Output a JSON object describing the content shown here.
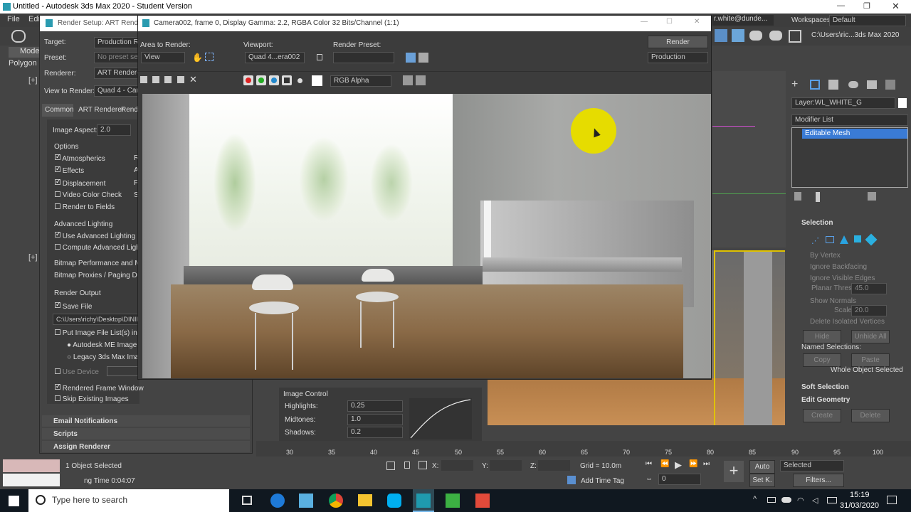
{
  "app_title": "Untitled - Autodesk 3ds Max 2020 - Student Version",
  "menu": [
    "File",
    "Edit"
  ],
  "account": "r.white@dunde...",
  "workspaces_label": "Workspaces:",
  "workspaces_value": "Default",
  "path_field": "C:\\Users\\ric...3ds Max 2020",
  "viewport_labels": {
    "top_left": "[+]",
    "mid_left": "[+]"
  },
  "left_toolbar": {
    "model_tab": "Model",
    "polygon_tab": "Polygon M"
  },
  "render_setup": {
    "title": "Render Setup: ART Rende",
    "target_label": "Target:",
    "target_value": "Production Ren",
    "preset_label": "Preset:",
    "preset_value": "No preset sele",
    "renderer_label": "Renderer:",
    "renderer_value": "ART Renderer",
    "view_label": "View to Render:",
    "view_value": "Quad 4 - Came",
    "tabs": [
      "Common",
      "ART Renderer",
      "Rende"
    ],
    "image_aspect_label": "Image Aspect:",
    "image_aspect_value": "2.0",
    "options_header": "Options",
    "options": [
      {
        "label": "Atmospherics",
        "checked": true
      },
      {
        "label": "Effects",
        "checked": true
      },
      {
        "label": "Displacement",
        "checked": true
      },
      {
        "label": "Video Color Check",
        "checked": false
      },
      {
        "label": "Render to Fields",
        "checked": false
      }
    ],
    "right_letters": [
      "R",
      "A",
      "F",
      "S"
    ],
    "advanced_lighting_header": "Advanced Lighting",
    "use_advanced_lighting": "Use Advanced Lighting",
    "compute_advanced_lighting": "Compute Advanced Lighting",
    "bitmap_performance": "Bitmap Performance and Memo",
    "bitmap_proxies": "Bitmap Proxies / Paging Disable",
    "render_output_header": "Render Output",
    "save_file": "Save File",
    "save_path": "C:\\Users\\richy\\Desktop\\DINING",
    "put_image_list": "Put Image File List(s) in Out",
    "autodesk_me": "Autodesk ME Image Se",
    "legacy": "Legacy 3ds Max Image",
    "use_device": "Use Device",
    "rendered_frame_window": "Rendered Frame Window",
    "skip_existing": "Skip Existing Images",
    "rollouts": [
      "Email Notifications",
      "Scripts",
      "Assign Renderer"
    ]
  },
  "render_frame": {
    "title": "Camera002, frame 0, Display Gamma: 2.2, RGBA Color 32 Bits/Channel (1:1)",
    "area_label": "Area to Render:",
    "area_value": "View",
    "viewport_label": "Viewport:",
    "viewport_value": "Quad 4...era002",
    "preset_label": "Render Preset:",
    "render_button": "Render",
    "production_value": "Production",
    "channel_value": "RGB Alpha"
  },
  "image_control": {
    "header": "Image Control",
    "highlights_label": "Highlights:",
    "highlights_value": "0.25",
    "midtones_label": "Midtones:",
    "midtones_value": "1.0",
    "shadows_label": "Shadows:",
    "shadows_value": "0.2"
  },
  "command_panel": {
    "layer": "Layer:WL_WHITE_G",
    "modifier_list": "Modifier List",
    "stack_item": "Editable Mesh",
    "selection_header": "Selection",
    "by_vertex": "By Vertex",
    "ignore_backfacing": "Ignore Backfacing",
    "ignore_visible_edges": "Ignore Visible Edges",
    "planar_thresh_label": "Planar Thresh:",
    "planar_thresh_value": "45.0",
    "show_normals": "Show Normals",
    "scale_label": "Scale:",
    "scale_value": "20.0",
    "delete_isolated": "Delete Isolated Vertices",
    "hide": "Hide",
    "unhide_all": "Unhide All",
    "named_selections": "Named Selections:",
    "copy": "Copy",
    "paste": "Paste",
    "whole_object": "Whole Object Selected",
    "soft_selection": "Soft Selection",
    "edit_geometry": "Edit Geometry",
    "create": "Create",
    "delete": "Delete"
  },
  "timeline_ticks": [
    "30",
    "35",
    "40",
    "45",
    "50",
    "55",
    "60",
    "65",
    "70",
    "75",
    "80",
    "85",
    "90",
    "95",
    "100"
  ],
  "status": {
    "objects_selected": "1 Object Selected",
    "render_time": "ng Time 0:04:07",
    "x_label": "X:",
    "y_label": "Y:",
    "z_label": "Z:",
    "grid": "Grid = 10.0m",
    "add_time_tag": "Add Time Tag",
    "auto": "Auto",
    "set_k": "Set K.",
    "selected": "Selected",
    "filters": "Filters...",
    "frame_value": "0"
  },
  "taskbar": {
    "search_placeholder": "Type here to search",
    "time": "15:19",
    "date": "31/03/2020"
  },
  "colors": {
    "accent_blue": "#3a7bd5",
    "bg_dark": "#444444",
    "yellow_cursor": "#e6dc00"
  }
}
